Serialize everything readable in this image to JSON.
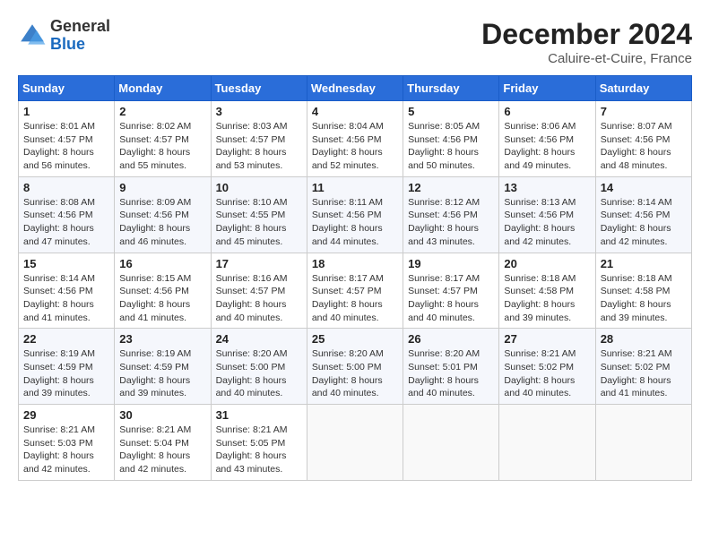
{
  "header": {
    "logo_general": "General",
    "logo_blue": "Blue",
    "month_title": "December 2024",
    "location": "Caluire-et-Cuire, France"
  },
  "weekdays": [
    "Sunday",
    "Monday",
    "Tuesday",
    "Wednesday",
    "Thursday",
    "Friday",
    "Saturday"
  ],
  "weeks": [
    [
      {
        "day": "1",
        "sunrise": "8:01 AM",
        "sunset": "4:57 PM",
        "daylight": "8 hours and 56 minutes."
      },
      {
        "day": "2",
        "sunrise": "8:02 AM",
        "sunset": "4:57 PM",
        "daylight": "8 hours and 55 minutes."
      },
      {
        "day": "3",
        "sunrise": "8:03 AM",
        "sunset": "4:57 PM",
        "daylight": "8 hours and 53 minutes."
      },
      {
        "day": "4",
        "sunrise": "8:04 AM",
        "sunset": "4:56 PM",
        "daylight": "8 hours and 52 minutes."
      },
      {
        "day": "5",
        "sunrise": "8:05 AM",
        "sunset": "4:56 PM",
        "daylight": "8 hours and 50 minutes."
      },
      {
        "day": "6",
        "sunrise": "8:06 AM",
        "sunset": "4:56 PM",
        "daylight": "8 hours and 49 minutes."
      },
      {
        "day": "7",
        "sunrise": "8:07 AM",
        "sunset": "4:56 PM",
        "daylight": "8 hours and 48 minutes."
      }
    ],
    [
      {
        "day": "8",
        "sunrise": "8:08 AM",
        "sunset": "4:56 PM",
        "daylight": "8 hours and 47 minutes."
      },
      {
        "day": "9",
        "sunrise": "8:09 AM",
        "sunset": "4:56 PM",
        "daylight": "8 hours and 46 minutes."
      },
      {
        "day": "10",
        "sunrise": "8:10 AM",
        "sunset": "4:55 PM",
        "daylight": "8 hours and 45 minutes."
      },
      {
        "day": "11",
        "sunrise": "8:11 AM",
        "sunset": "4:56 PM",
        "daylight": "8 hours and 44 minutes."
      },
      {
        "day": "12",
        "sunrise": "8:12 AM",
        "sunset": "4:56 PM",
        "daylight": "8 hours and 43 minutes."
      },
      {
        "day": "13",
        "sunrise": "8:13 AM",
        "sunset": "4:56 PM",
        "daylight": "8 hours and 42 minutes."
      },
      {
        "day": "14",
        "sunrise": "8:14 AM",
        "sunset": "4:56 PM",
        "daylight": "8 hours and 42 minutes."
      }
    ],
    [
      {
        "day": "15",
        "sunrise": "8:14 AM",
        "sunset": "4:56 PM",
        "daylight": "8 hours and 41 minutes."
      },
      {
        "day": "16",
        "sunrise": "8:15 AM",
        "sunset": "4:56 PM",
        "daylight": "8 hours and 41 minutes."
      },
      {
        "day": "17",
        "sunrise": "8:16 AM",
        "sunset": "4:57 PM",
        "daylight": "8 hours and 40 minutes."
      },
      {
        "day": "18",
        "sunrise": "8:17 AM",
        "sunset": "4:57 PM",
        "daylight": "8 hours and 40 minutes."
      },
      {
        "day": "19",
        "sunrise": "8:17 AM",
        "sunset": "4:57 PM",
        "daylight": "8 hours and 40 minutes."
      },
      {
        "day": "20",
        "sunrise": "8:18 AM",
        "sunset": "4:58 PM",
        "daylight": "8 hours and 39 minutes."
      },
      {
        "day": "21",
        "sunrise": "8:18 AM",
        "sunset": "4:58 PM",
        "daylight": "8 hours and 39 minutes."
      }
    ],
    [
      {
        "day": "22",
        "sunrise": "8:19 AM",
        "sunset": "4:59 PM",
        "daylight": "8 hours and 39 minutes."
      },
      {
        "day": "23",
        "sunrise": "8:19 AM",
        "sunset": "4:59 PM",
        "daylight": "8 hours and 39 minutes."
      },
      {
        "day": "24",
        "sunrise": "8:20 AM",
        "sunset": "5:00 PM",
        "daylight": "8 hours and 40 minutes."
      },
      {
        "day": "25",
        "sunrise": "8:20 AM",
        "sunset": "5:00 PM",
        "daylight": "8 hours and 40 minutes."
      },
      {
        "day": "26",
        "sunrise": "8:20 AM",
        "sunset": "5:01 PM",
        "daylight": "8 hours and 40 minutes."
      },
      {
        "day": "27",
        "sunrise": "8:21 AM",
        "sunset": "5:02 PM",
        "daylight": "8 hours and 40 minutes."
      },
      {
        "day": "28",
        "sunrise": "8:21 AM",
        "sunset": "5:02 PM",
        "daylight": "8 hours and 41 minutes."
      }
    ],
    [
      {
        "day": "29",
        "sunrise": "8:21 AM",
        "sunset": "5:03 PM",
        "daylight": "8 hours and 42 minutes."
      },
      {
        "day": "30",
        "sunrise": "8:21 AM",
        "sunset": "5:04 PM",
        "daylight": "8 hours and 42 minutes."
      },
      {
        "day": "31",
        "sunrise": "8:21 AM",
        "sunset": "5:05 PM",
        "daylight": "8 hours and 43 minutes."
      },
      null,
      null,
      null,
      null
    ]
  ],
  "labels": {
    "sunrise": "Sunrise:",
    "sunset": "Sunset:",
    "daylight": "Daylight:"
  }
}
